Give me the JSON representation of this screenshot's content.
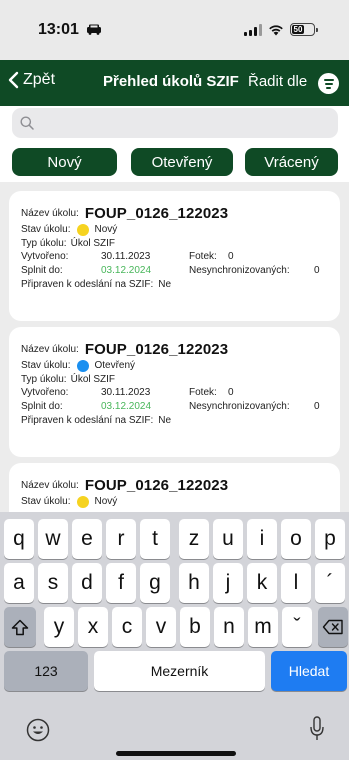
{
  "status": {
    "time": "13:01",
    "battery": "50"
  },
  "header": {
    "back_label": "Zpět",
    "title": "Přehled úkolů SZIF",
    "sort_label": "Řadit dle"
  },
  "search": {
    "placeholder": ""
  },
  "filters": [
    "Nový",
    "Otevřený",
    "Vrácený"
  ],
  "labels": {
    "task_name": "Název úkolu:",
    "state": "Stav úkolu:",
    "type": "Typ úkolu:",
    "created": "Vytvořeno:",
    "photos": "Fotek:",
    "due": "Splnit do:",
    "unsynced": "Nesynchronizovaných:",
    "ready": "Připraven k odeslání na SZIF:"
  },
  "tasks": [
    {
      "name": "FOUP_0126_122023",
      "state": "Nový",
      "state_color": "#f6d320",
      "type": "Úkol SZIF",
      "created": "30.11.2023",
      "photos": "0",
      "due": "03.12.2024",
      "unsynced": "0",
      "ready": "Ne"
    },
    {
      "name": "FOUP_0126_122023",
      "state": "Otevřený",
      "state_color": "#1a8ff0",
      "type": "Úkol SZIF",
      "created": "30.11.2023",
      "photos": "0",
      "due": "03.12.2024",
      "unsynced": "0",
      "ready": "Ne"
    },
    {
      "name": "FOUP_0126_122023",
      "state": "Nový",
      "state_color": "#f6d320"
    }
  ],
  "keyboard": {
    "row1": [
      "q",
      "w",
      "e",
      "r",
      "t",
      "z",
      "u",
      "i",
      "o",
      "p"
    ],
    "row2": [
      "a",
      "s",
      "d",
      "f",
      "g",
      "h",
      "j",
      "k",
      "l",
      "´"
    ],
    "row3": [
      "y",
      "x",
      "c",
      "v",
      "b",
      "n",
      "m",
      "ˇ"
    ],
    "numbers": "123",
    "space": "Mezerník",
    "action": "Hledat"
  },
  "colors": {
    "brand": "#0f4a25",
    "due": "#48b65a",
    "keyboard_action": "#1e7cf2"
  }
}
